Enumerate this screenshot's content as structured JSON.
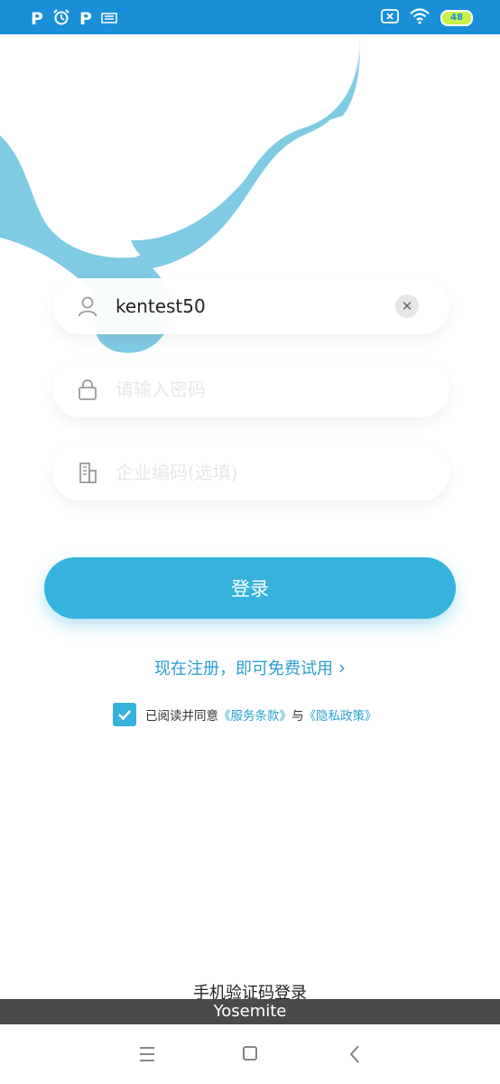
{
  "status_bar": {
    "left_icons": [
      "p-app-icon",
      "alarm-icon",
      "p-app-icon",
      "keyboard-icon"
    ],
    "p_logo": "P",
    "battery": "48"
  },
  "login_form": {
    "username": {
      "value": "kentest50",
      "placeholder": ""
    },
    "password": {
      "value": "",
      "placeholder": "请输入密码"
    },
    "company": {
      "value": "",
      "placeholder": "企业编码(选填)"
    },
    "login_button": "登录"
  },
  "register_link": "现在注册，即可免费试用",
  "agreement": {
    "checked": true,
    "prefix": "已阅读并同意",
    "terms": "《服务条款》",
    "conjunction": "与",
    "privacy": "《隐私政策》"
  },
  "sms_login": "手机验证码登录",
  "toast": "Yosemite",
  "colors": {
    "accent": "#35b3dc",
    "status_bar": "#1a8fd8",
    "decor": "#7fcbe3",
    "link": "#2b9fcf"
  }
}
